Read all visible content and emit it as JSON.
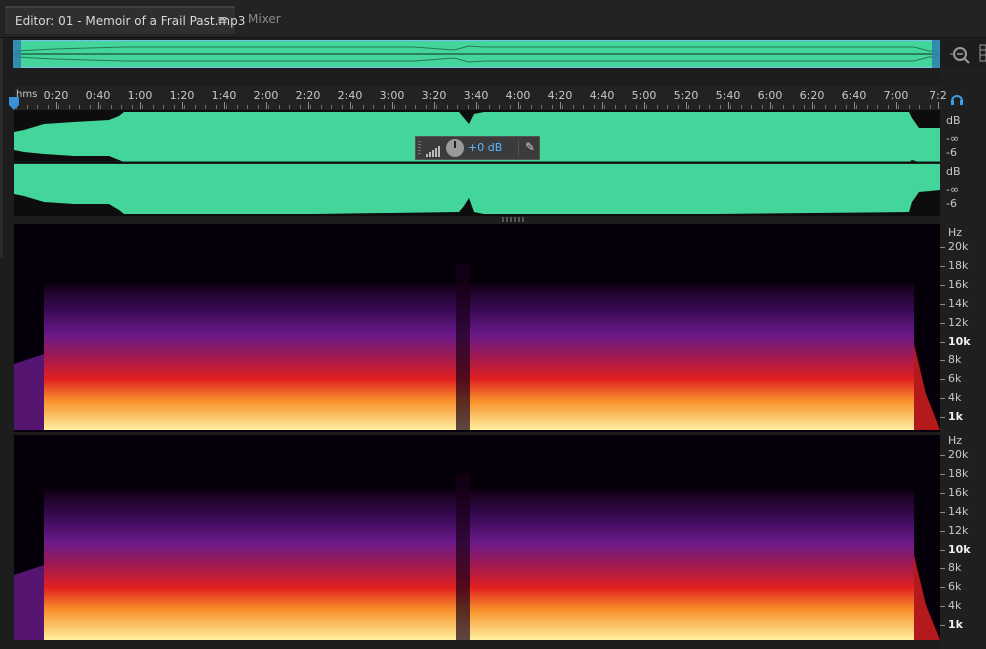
{
  "tabs": [
    {
      "label": "Editor: 01 - Memoir of a Frail Past.mp3",
      "menu_glyph": "≡",
      "active": true
    },
    {
      "label": "Mixer",
      "active": false
    }
  ],
  "ruler": {
    "units": "hms",
    "labels": [
      "0:20",
      "0:40",
      "1:00",
      "1:20",
      "1:40",
      "2:00",
      "2:20",
      "2:40",
      "3:00",
      "3:20",
      "3:40",
      "4:00",
      "4:20",
      "4:40",
      "5:00",
      "5:20",
      "5:40",
      "6:00",
      "6:20",
      "6:40",
      "7:00",
      "7:2"
    ]
  },
  "waveform": {
    "color": "#44d59a",
    "db_labels": {
      "unit": "dB",
      "inf": "-∞",
      "minus6": "-6"
    }
  },
  "hud": {
    "value": "+0 dB"
  },
  "spectral": {
    "unit": "Hz",
    "labels": [
      "20k",
      "18k",
      "16k",
      "14k",
      "12k",
      "10k",
      "8k",
      "6k",
      "4k",
      "1k"
    ],
    "bold_labels": [
      "10k",
      "1k"
    ]
  },
  "icons": {
    "zoom": "zoom-in-icon",
    "panel_menu": "panel-menu-icon",
    "monitor": "headphones-icon",
    "meter": "meter-icon",
    "pin": "pin-icon",
    "playhead": "playhead-icon"
  }
}
